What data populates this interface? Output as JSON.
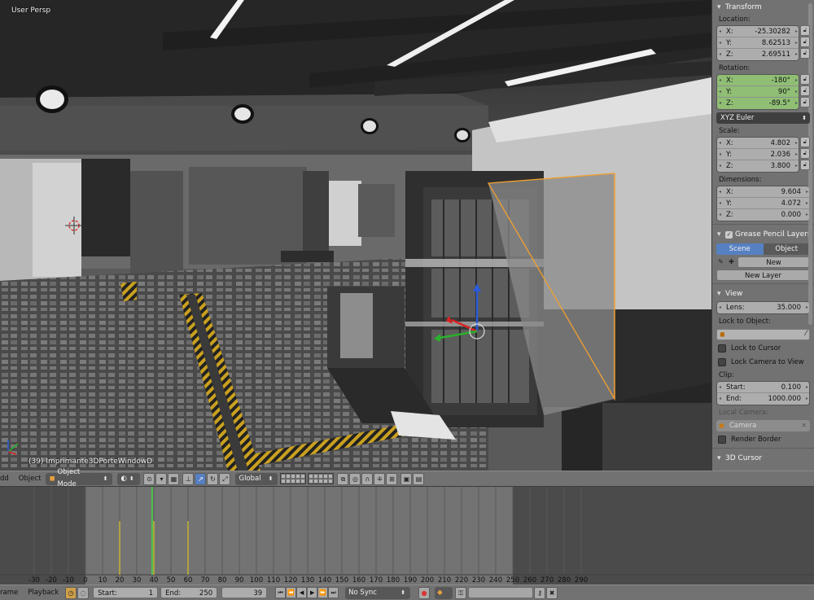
{
  "viewport": {
    "view_name": "User Persp",
    "object_info": "(39) Imprimante3DPorteWindowD"
  },
  "panel": {
    "transform": {
      "title": "Transform",
      "location_label": "Location:",
      "location": [
        {
          "axis": "X:",
          "value": "-25.30282"
        },
        {
          "axis": "Y:",
          "value": "8.62513"
        },
        {
          "axis": "Z:",
          "value": "2.69511"
        }
      ],
      "rotation_label": "Rotation:",
      "rotation": [
        {
          "axis": "X:",
          "value": "-180°"
        },
        {
          "axis": "Y:",
          "value": "90°"
        },
        {
          "axis": "Z:",
          "value": "-89.5°"
        }
      ],
      "rotation_mode": "XYZ Euler",
      "scale_label": "Scale:",
      "scale": [
        {
          "axis": "X:",
          "value": "4.802"
        },
        {
          "axis": "Y:",
          "value": "2.036"
        },
        {
          "axis": "Z:",
          "value": "3.800"
        }
      ],
      "dimensions_label": "Dimensions:",
      "dimensions": [
        {
          "axis": "X:",
          "value": "9.604"
        },
        {
          "axis": "Y:",
          "value": "4.072"
        },
        {
          "axis": "Z:",
          "value": "0.000"
        }
      ]
    },
    "grease_pencil": {
      "title": "Grease Pencil Layers",
      "tab_scene": "Scene",
      "tab_object": "Object",
      "new_label": "New",
      "new_layer_label": "New Layer"
    },
    "view": {
      "title": "View",
      "lens_label": "Lens:",
      "lens_value": "35.000",
      "lock_to_object_label": "Lock to Object:",
      "lock_to_cursor": "Lock to Cursor",
      "lock_camera_to_view": "Lock Camera to View",
      "clip_label": "Clip:",
      "clip_start_label": "Start:",
      "clip_start": "0.100",
      "clip_end_label": "End:",
      "clip_end": "1000.000",
      "local_camera_label": "Local Camera:",
      "camera_value": "Camera",
      "render_border": "Render Border"
    },
    "cursor_title": "3D Cursor"
  },
  "view_header": {
    "menu_add": "dd",
    "menu_object": "Object",
    "mode": "Object Mode",
    "orientation": "Global"
  },
  "timeline": {
    "ticks": [
      -30,
      -20,
      -10,
      0,
      10,
      20,
      30,
      40,
      50,
      60,
      70,
      80,
      90,
      100,
      110,
      120,
      130,
      140,
      150,
      160,
      170,
      180,
      190,
      200,
      210,
      220,
      230,
      240,
      250,
      260,
      270,
      280,
      290
    ],
    "current_frame": 39,
    "keyframes": [
      20,
      40,
      60
    ],
    "range_start": 0,
    "range_end": 250
  },
  "timeline_header": {
    "menu_frame": "rame",
    "menu_playback": "Playback",
    "start_label": "Start:",
    "start_value": "1",
    "end_label": "End:",
    "end_value": "250",
    "current_value": "39",
    "sync": "No Sync"
  },
  "colors": {
    "selection_outline": "#f0a030",
    "current_frame_line": "#4fc24f",
    "keyframe_line": "#d9c11e",
    "active_tab": "#5680c2",
    "rotation_field": "#8fbe74"
  }
}
